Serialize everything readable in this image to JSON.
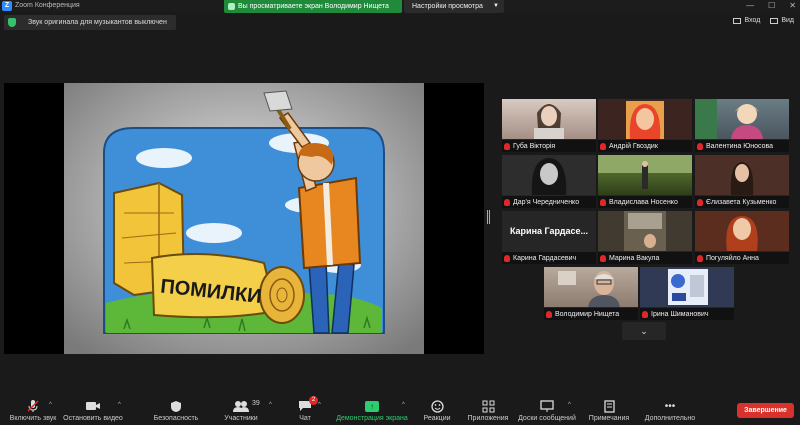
{
  "window": {
    "title": "Zoom Конференция",
    "logo": "Z"
  },
  "banner": {
    "sharing_text": "Вы просматриваете экран Володимир Нищета",
    "view_options_label": "Настройки просмотра"
  },
  "sound_badge": {
    "text": "Звук оригинала для музыкантов выключен"
  },
  "top_right": {
    "speaker_label": "Вход",
    "view_label": "Вид"
  },
  "slide": {
    "word": "ПОМИЛКИ"
  },
  "participants": [
    {
      "name": "Губа Вікторія",
      "video": "#c8b9b0"
    },
    {
      "name": "Андрій Гвоздик",
      "video": "#3c2420"
    },
    {
      "name": "Валентина Юносова",
      "video": "#5c6a72"
    },
    {
      "name": "Дар'я Чередниченко",
      "video": "#2d2d2d"
    },
    {
      "name": "Владислава Носенко",
      "video": "#3a4b23"
    },
    {
      "name": "Єлизавета Кузьменко",
      "video": "#4c3028"
    },
    {
      "name": "Карина Гардасевич",
      "video": "#242424",
      "display_text": "Карина Гардасе..."
    },
    {
      "name": "Марина Вакула",
      "video": "#403a30"
    },
    {
      "name": "Погуляйло Анна",
      "video": "#5a2d1e"
    },
    {
      "name": "Володимир Нищета",
      "video": "#a19284"
    },
    {
      "name": "Ірина Шиманович",
      "video": "#303a55"
    }
  ],
  "pager": {
    "label": "⌄"
  },
  "toolbar": {
    "mute": "Включить звук",
    "video": "Остановить видео",
    "security": "Безопасность",
    "participants": "Участники",
    "participants_count": "39",
    "chat": "Чат",
    "chat_badge": "2",
    "share": "Демонстрация экрана",
    "reactions": "Реакции",
    "apps": "Приложения",
    "whiteboard": "Доски сообщений",
    "notes": "Примечания",
    "more": "Дополнительно",
    "end": "Завершение"
  },
  "colors": {
    "share_green": "#1f8b3a",
    "end_red": "#d9312b",
    "mic_red": "#e02828"
  }
}
